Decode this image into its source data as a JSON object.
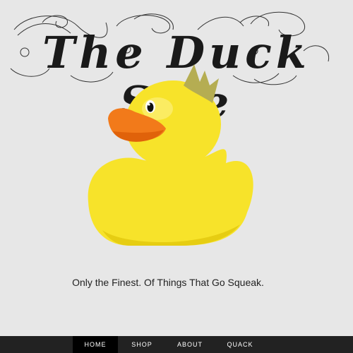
{
  "site": {
    "title": "The Duck Site",
    "tagline": "Only the Finest. Of Things That Go Squeak."
  },
  "hero": {
    "image_icon": "rubber-duck-with-crown",
    "colors": {
      "duck_yellow": "#f7e32a",
      "beak_orange": "#f27a1a",
      "crown_olive": "#b5ad52"
    }
  },
  "nav": {
    "items": [
      {
        "label": "HOME",
        "active": true
      },
      {
        "label": "SHOP",
        "active": false
      },
      {
        "label": "ABOUT",
        "active": false
      },
      {
        "label": "QUACK",
        "active": false
      }
    ],
    "colors": {
      "bar": "#222222",
      "active": "#000000",
      "text": "#ffffff"
    }
  },
  "colors": {
    "background": "#e7e7e7"
  }
}
